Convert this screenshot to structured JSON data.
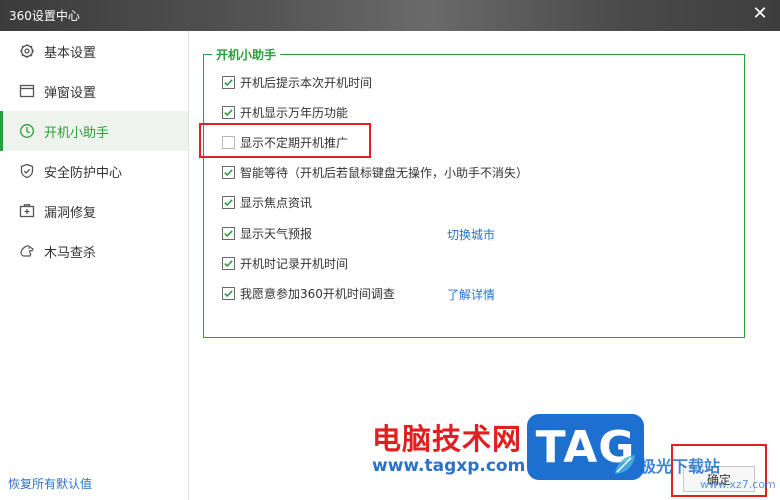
{
  "window": {
    "title": "360设置中心",
    "close_glyph": "✕"
  },
  "sidebar": {
    "items": [
      {
        "label": "基本设置",
        "icon": "gear-icon"
      },
      {
        "label": "弹窗设置",
        "icon": "window-icon"
      },
      {
        "label": "开机小助手",
        "icon": "clock-icon",
        "active": true
      },
      {
        "label": "安全防护中心",
        "icon": "shield-icon"
      },
      {
        "label": "漏洞修复",
        "icon": "patch-icon"
      },
      {
        "label": "木马查杀",
        "icon": "horse-icon"
      }
    ],
    "restore_link": "恢复所有默认值"
  },
  "panel": {
    "legend": "开机小助手",
    "options": [
      {
        "label": "开机后提示本次开机时间",
        "checked": true
      },
      {
        "label": "开机显示万年历功能",
        "checked": true
      },
      {
        "label": "显示不定期开机推广",
        "checked": false
      },
      {
        "label": "智能等待（开机后若鼠标键盘无操作，小助手不消失）",
        "checked": true
      },
      {
        "label": "显示焦点资讯",
        "checked": true
      },
      {
        "label": "显示天气预报",
        "checked": true
      },
      {
        "label": "开机时记录开机时间",
        "checked": true
      },
      {
        "label": "我愿意参加360开机时间调查",
        "checked": true
      }
    ],
    "links": {
      "switch_city": "切换城市",
      "learn_more": "了解详情"
    }
  },
  "footer": {
    "confirm_label": "确定"
  },
  "watermark": {
    "site_name": "电脑技术网",
    "site_url": "www.tagxp.com",
    "tag_logo": "TAG",
    "jg_name": "极光下载站",
    "jg_url": "www.xz7.com"
  },
  "colors": {
    "accent": "#2b9e3a",
    "link": "#2a73c8",
    "highlight": "#e02020"
  }
}
